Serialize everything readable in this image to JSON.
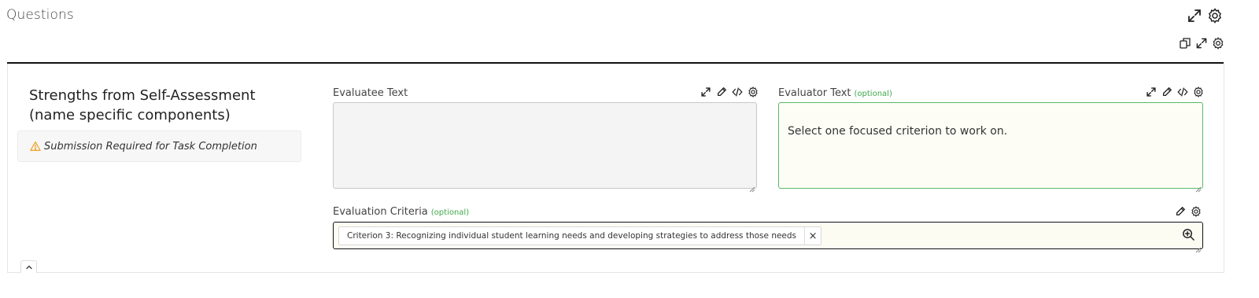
{
  "page": {
    "title": "Questions"
  },
  "question": {
    "title_line1": "Strengths from Self-Assessment",
    "title_line2": "(name specific components)",
    "notice": "Submission Required for Task Completion"
  },
  "evaluatee": {
    "label": "Evaluatee Text",
    "value": ""
  },
  "evaluator": {
    "label": "Evaluator Text",
    "optional": "(optional)",
    "value": "Select one focused criterion to work on."
  },
  "criteria": {
    "label": "Evaluation Criteria",
    "optional": "(optional)",
    "chip": "Criterion 3: Recognizing individual student learning needs and developing strategies to address those needs",
    "remove": "×"
  },
  "colors": {
    "optional_green": "#3ea84a",
    "warning_orange": "#f0a020",
    "evaluator_border": "#59b96a"
  },
  "icons": [
    "expand-icon",
    "gear-icon",
    "copy-icon",
    "pencil-icon",
    "code-icon",
    "magnify-plus-icon",
    "warning-icon",
    "chevron-up-icon"
  ]
}
